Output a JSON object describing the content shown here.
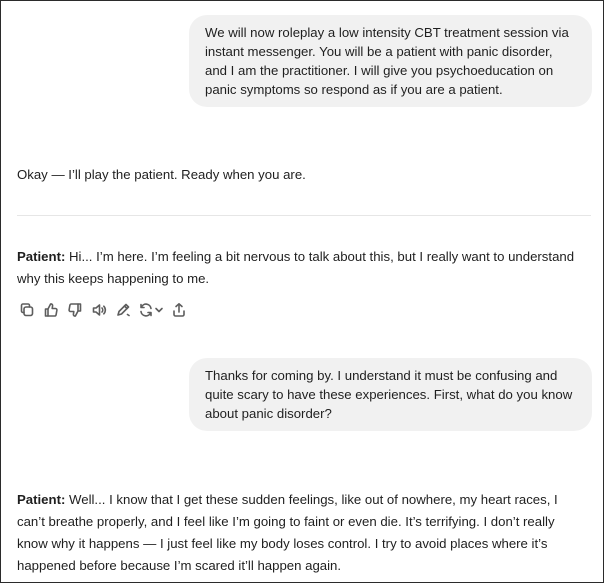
{
  "messages": [
    {
      "role": "user",
      "text": "We will now roleplay a low intensity CBT treatment session via instant messenger. You will be a patient with panic disorder, and I am the practitioner. I will give you psychoeducation on panic symptoms so respond as if you are a patient."
    },
    {
      "role": "assistant",
      "text": "Okay — I’ll play the patient. Ready when you are."
    },
    {
      "role": "assistant",
      "speaker": "Patient:",
      "text": " Hi... I’m here. I’m feeling a bit nervous to talk about this, but I really want to understand why this keeps happening to me."
    },
    {
      "role": "user",
      "text": "Thanks for coming by. I understand it must be confusing and quite scary to have these experiences. First, what do you know about panic disorder?"
    },
    {
      "role": "assistant",
      "speaker": "Patient:",
      "text": " Well... I know that I get these sudden feelings, like out of nowhere, my heart races, I can’t breathe properly, and I feel like I’m going to faint or even die. It’s terrifying. I don’t really know why it happens — I just feel like my body loses control. I try to avoid places where it’s happened before because I’m scared it’ll happen again."
    }
  ],
  "actions": {
    "icons": [
      "copy-icon",
      "thumbs-up-icon",
      "thumbs-down-icon",
      "read-aloud-icon",
      "edit-icon",
      "regenerate-icon",
      "share-icon"
    ]
  }
}
